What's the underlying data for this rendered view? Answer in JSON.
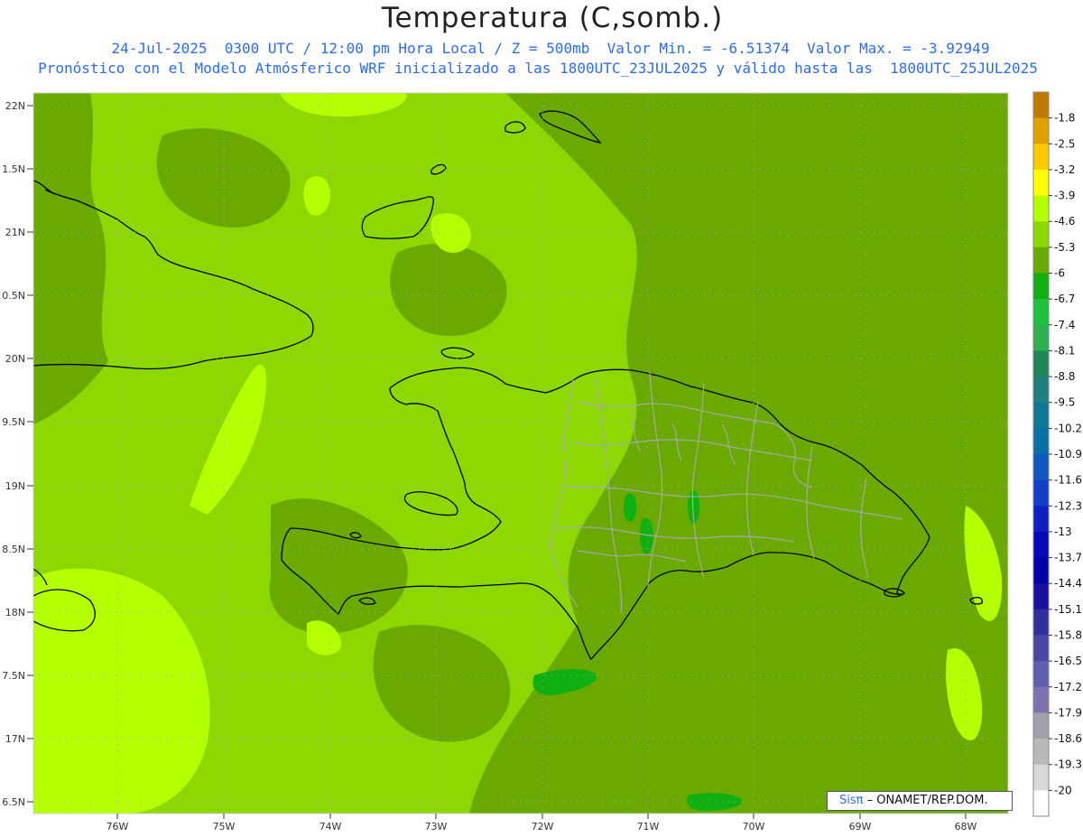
{
  "title": "Temperatura (C,somb.)",
  "subtitle_line1": "24-Jul-2025  0300 UTC / 12:00 pm Hora Local / Z = 500mb  Valor Min. = -6.51374  Valor Max. = -3.92949",
  "subtitle_line2": "Pronóstico con el Modelo Atmósferico WRF inicializado a las 1800UTC_23JUL2025 y válido hasta las  1800UTC_25JUL2025",
  "credit": {
    "brand": "Sisπ",
    "text": " – ONAMET/REP.DOM."
  },
  "map": {
    "lat_labels": [
      "22N",
      "1.5N",
      "21N",
      "0.5N",
      "20N",
      "9.5N",
      "19N",
      "8.5N",
      "18N",
      "7.5N",
      "17N",
      "6.5N"
    ],
    "lon_labels": [
      "76W",
      "75W",
      "74W",
      "73W",
      "72W",
      "71W",
      "70W",
      "69W",
      "68W"
    ],
    "colors": {
      "land_outline": "#000000",
      "province_lines": "#a8a8a8",
      "grid_dots": "#b0a0c8"
    }
  },
  "colorbar": {
    "labels": [
      "-1.8",
      "-2.5",
      "-3.2",
      "-3.9",
      "-4.6",
      "-5.3",
      "-6",
      "-6.7",
      "-7.4",
      "-8.1",
      "-8.8",
      "-9.5",
      "-10.2",
      "-10.9",
      "-11.6",
      "-12.3",
      "-13",
      "-13.7",
      "-14.4",
      "-15.1",
      "-15.8",
      "-16.5",
      "-17.2",
      "-17.9",
      "-18.6",
      "-19.3",
      "-20"
    ],
    "colors": [
      "#c07800",
      "#e0a000",
      "#ffc800",
      "#ffff00",
      "#b4ff00",
      "#8cd800",
      "#6aaa00",
      "#10b010",
      "#20c040",
      "#30b050",
      "#208858",
      "#208080",
      "#107890",
      "#0870a8",
      "#1058c0",
      "#1040c8",
      "#1020c0",
      "#0808b8",
      "#0000a8",
      "#1810a0",
      "#3030a0",
      "#4848a8",
      "#6060b0",
      "#8070b0",
      "#a0a0a8",
      "#b8b8b8",
      "#d8d8d8",
      "#ffffff"
    ]
  }
}
